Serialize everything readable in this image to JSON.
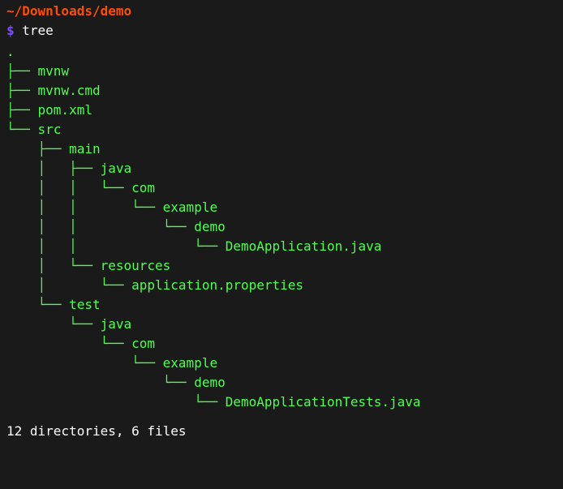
{
  "cwd": "~/Downloads/demo",
  "prompt_symbol": "$",
  "command": "tree",
  "tree_lines": [
    ".",
    "├── mvnw",
    "├── mvnw.cmd",
    "├── pom.xml",
    "└── src",
    "    ├── main",
    "    │   ├── java",
    "    │   │   └── com",
    "    │   │       └── example",
    "    │   │           └── demo",
    "    │   │               └── DemoApplication.java",
    "    │   └── resources",
    "    │       └── application.properties",
    "    └── test",
    "        └── java",
    "            └── com",
    "                └── example",
    "                    └── demo",
    "                        └── DemoApplicationTests.java"
  ],
  "summary": "12 directories, 6 files"
}
